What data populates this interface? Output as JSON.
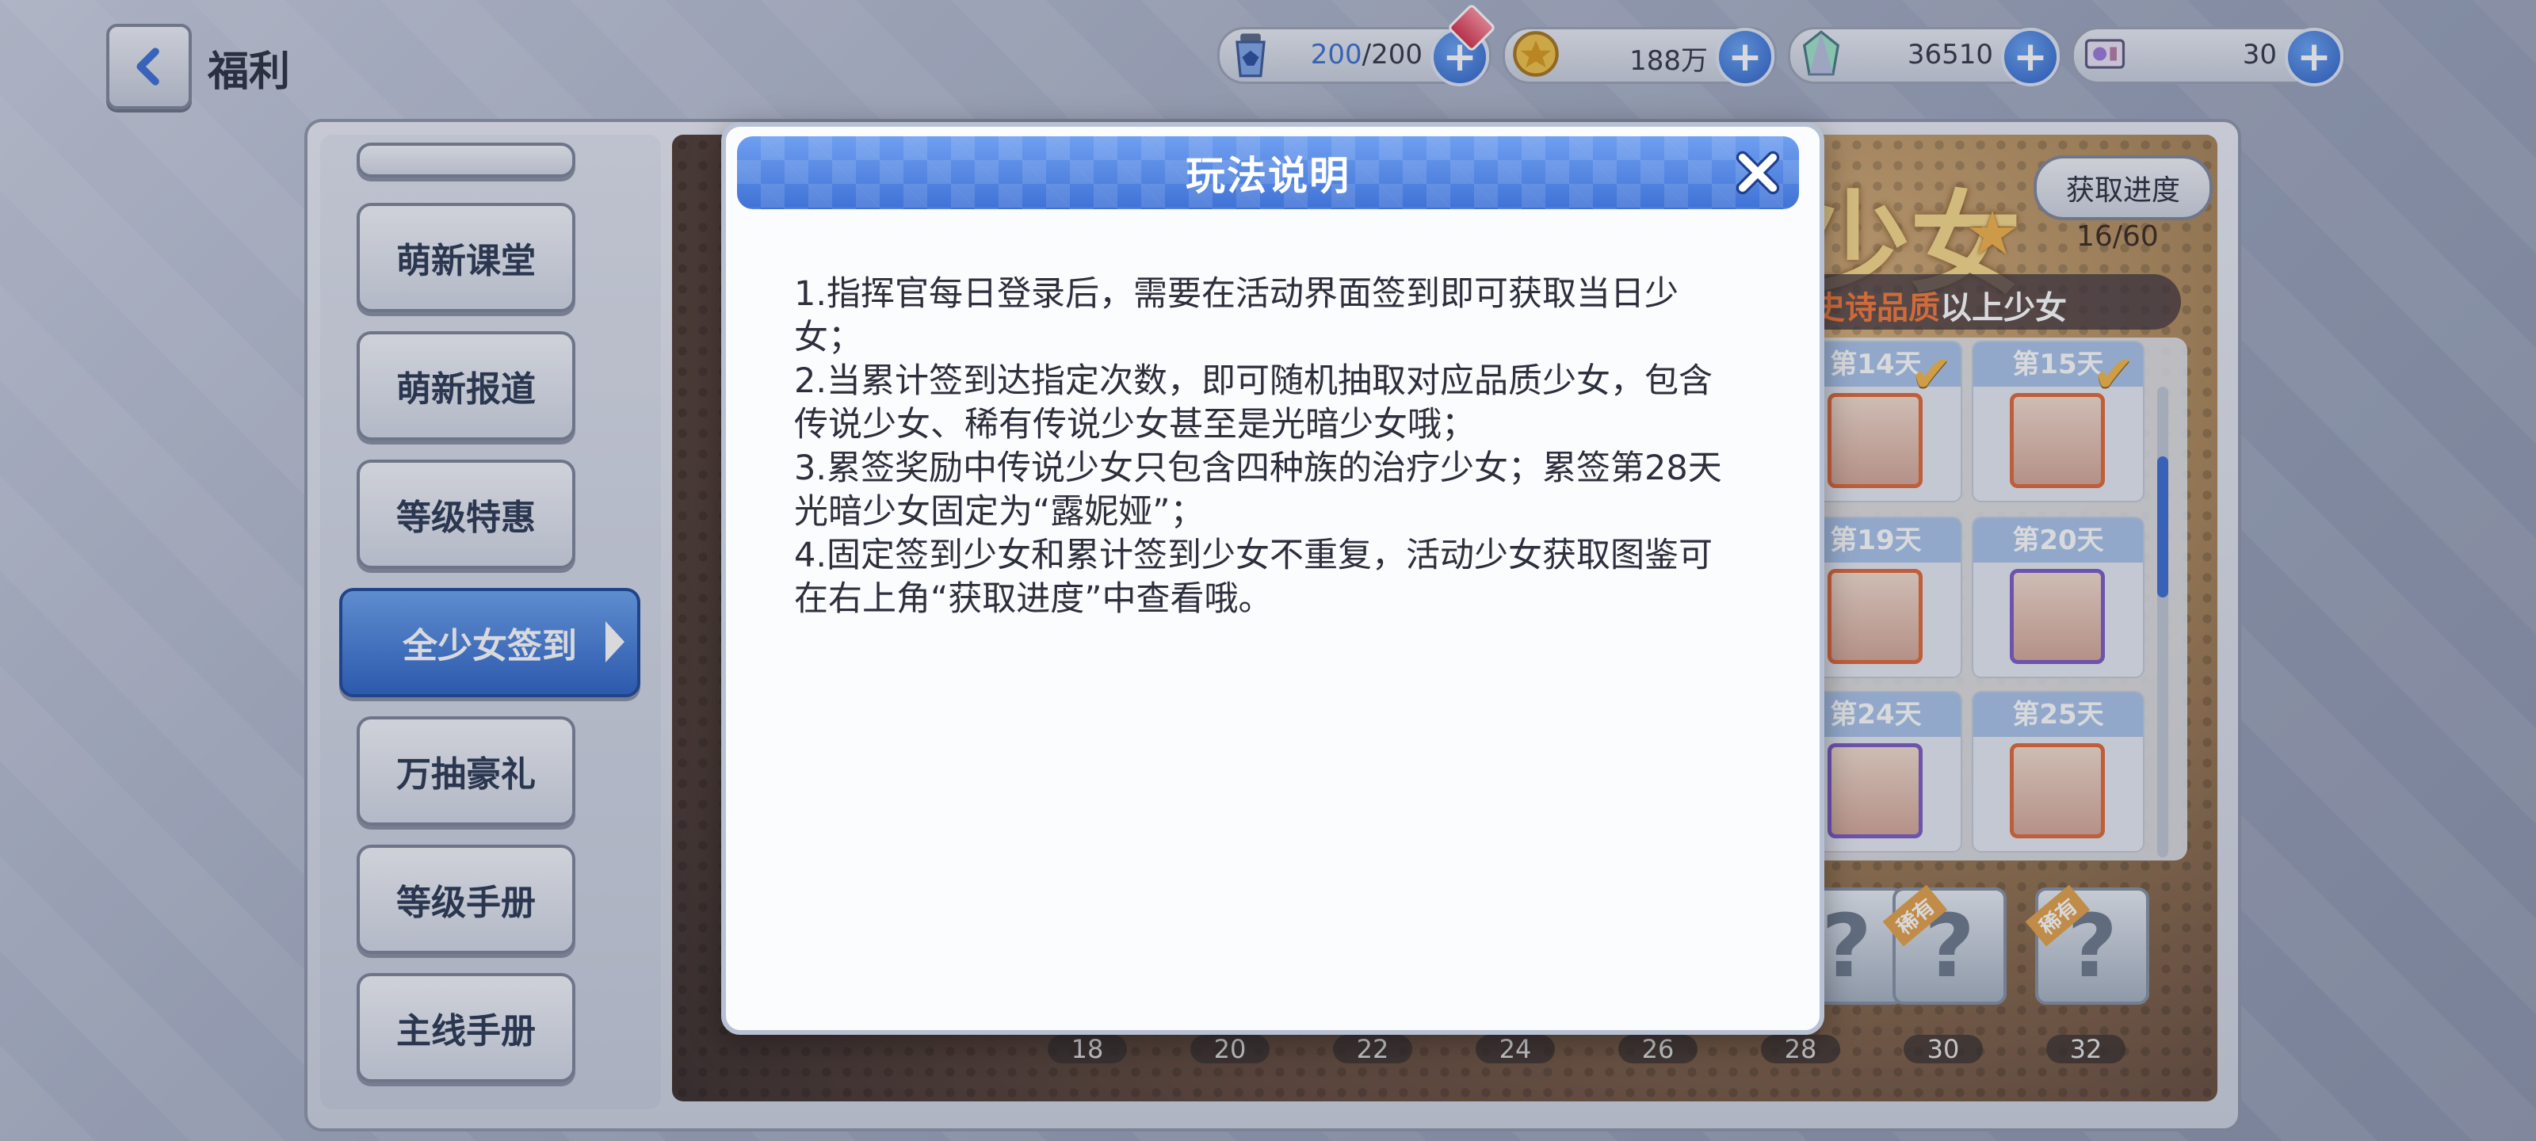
{
  "header": {
    "title": "福利"
  },
  "resources": {
    "stamina": {
      "current": "200",
      "sep_max": "/200",
      "icon": "stamina-bottle-icon"
    },
    "gold": {
      "value": "188万",
      "icon": "gold-coin-icon"
    },
    "crystal": {
      "value": "36510",
      "icon": "crystal-icon"
    },
    "ticket": {
      "value": "30",
      "icon": "ticket-icon"
    }
  },
  "sidebar": {
    "items": [
      {
        "label": "萌新课堂"
      },
      {
        "label": "萌新报道"
      },
      {
        "label": "等级特惠"
      },
      {
        "label": "全少女签到",
        "active": true
      },
      {
        "label": "万抽豪礼"
      },
      {
        "label": "等级手册"
      },
      {
        "label": "主线手册"
      }
    ]
  },
  "event": {
    "title_fragment": "少女",
    "progress_button": "获取进度",
    "progress_count": "16/60",
    "quality_highlight": "史诗品质",
    "quality_suffix": "以上少女",
    "days": [
      "第14天",
      "第15天",
      "第19天",
      "第20天",
      "第24天",
      "第25天"
    ],
    "mystery_tag": "稀有",
    "ticks": [
      "18",
      "20",
      "22",
      "24",
      "26",
      "28",
      "30",
      "32"
    ]
  },
  "modal": {
    "title": "玩法说明",
    "lines": [
      "1.指挥官每日登录后，需要在活动界面签到即可获取当日少女；",
      "2.当累计签到达指定次数，即可随机抽取对应品质少女，包含传说少女、稀有传说少女甚至是光暗少女哦；",
      "3.累签奖励中传说少女只包含四种族的治疗少女；累签第28天光暗少女固定为“露妮娅”；",
      "4.固定签到少女和累计签到少女不重复，活动少女获取图鉴可在右上角“获取进度”中查看哦。"
    ]
  },
  "colors": {
    "accent": "#3f72d6",
    "highlight": "#f5793a"
  }
}
